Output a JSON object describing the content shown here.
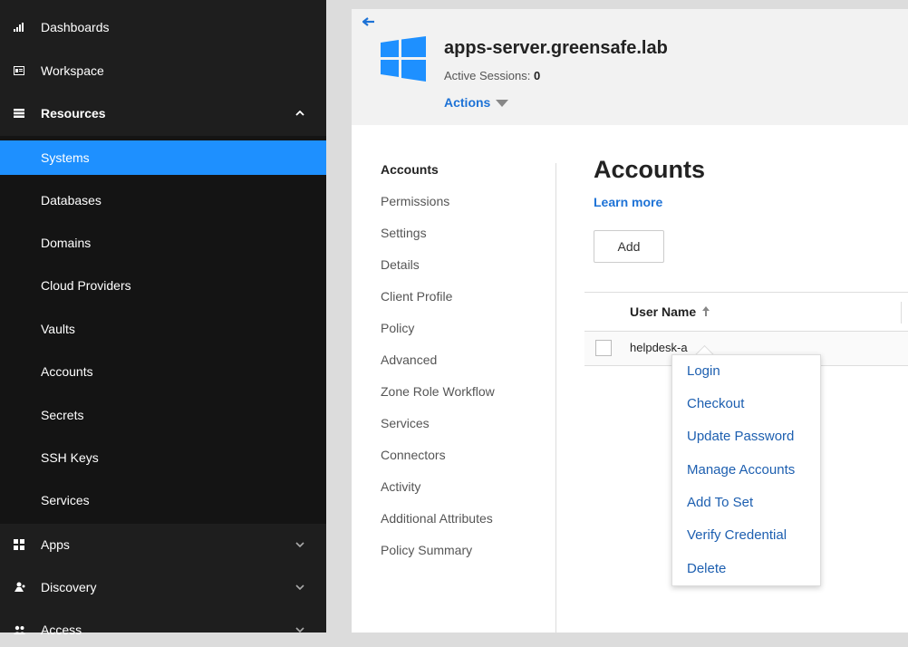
{
  "sidebar": {
    "items": [
      {
        "label": "Dashboards",
        "icon": "bar-chart-icon"
      },
      {
        "label": "Workspace",
        "icon": "workspace-card-icon"
      },
      {
        "label": "Resources",
        "icon": "server-list-icon",
        "expanded": true
      },
      {
        "label": "Systems",
        "active": true
      },
      {
        "label": "Databases"
      },
      {
        "label": "Domains"
      },
      {
        "label": "Cloud Providers"
      },
      {
        "label": "Vaults"
      },
      {
        "label": "Accounts"
      },
      {
        "label": "Secrets"
      },
      {
        "label": "SSH Keys"
      },
      {
        "label": "Services"
      },
      {
        "label": "Apps",
        "icon": "apps-grid-icon"
      },
      {
        "label": "Discovery",
        "icon": "discovery-icon"
      },
      {
        "label": "Access",
        "icon": "users-icon"
      }
    ]
  },
  "header": {
    "title": "apps-server.greensafe.lab",
    "sessions_label": "Active Sessions:",
    "sessions_count": "0",
    "actions_label": "Actions"
  },
  "subnav": {
    "items": [
      "Accounts",
      "Permissions",
      "Settings",
      "Details",
      "Client Profile",
      "Policy",
      "Advanced",
      "Zone Role Workflow",
      "Services",
      "Connectors",
      "Activity",
      "Additional Attributes",
      "Policy Summary"
    ]
  },
  "main": {
    "title": "Accounts",
    "learn_more": "Learn more",
    "add_label": "Add",
    "table": {
      "columns": [
        "User Name"
      ],
      "rows": [
        {
          "user": "helpdesk-a"
        }
      ]
    }
  },
  "context_menu": {
    "items": [
      "Login",
      "Checkout",
      "Update Password",
      "Manage Accounts",
      "Add To Set",
      "Verify Credential",
      "Delete"
    ]
  },
  "colors": {
    "accent": "#1e90ff",
    "link": "#1d72d6",
    "sidebar_bg": "#1e1e1e"
  }
}
